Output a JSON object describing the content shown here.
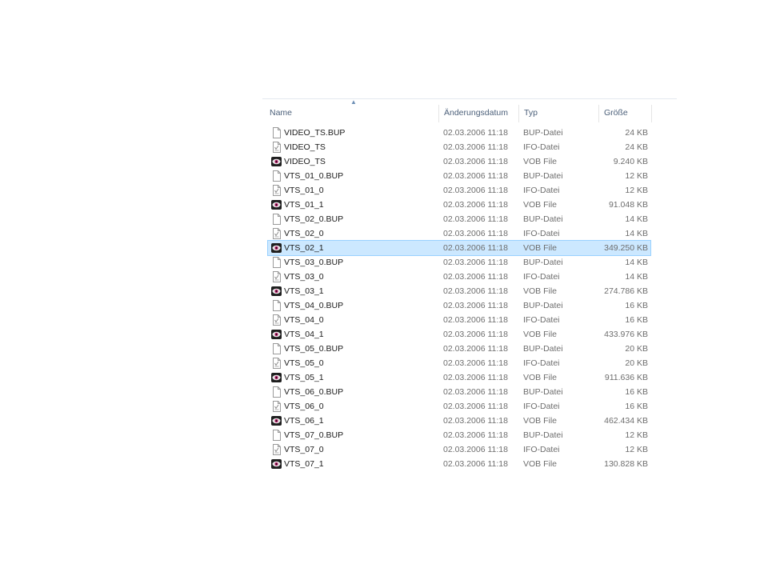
{
  "columns": {
    "name": "Name",
    "date": "Änderungsdatum",
    "type": "Typ",
    "size": "Größe"
  },
  "sort": {
    "column": "name",
    "direction": "ascending"
  },
  "colors": {
    "selected_bg": "#cce8ff",
    "selected_border": "#99d1ff",
    "header_text": "#4c607a",
    "detail_text": "#6d6d6d"
  },
  "files": [
    {
      "name": "VIDEO_TS.BUP",
      "date": "02.03.2006 11:18",
      "type": "BUP-Datei",
      "size": "24 KB",
      "icon": "blank-file-icon"
    },
    {
      "name": "VIDEO_TS",
      "date": "02.03.2006 11:18",
      "type": "IFO-Datei",
      "size": "24 KB",
      "icon": "info-file-icon"
    },
    {
      "name": "VIDEO_TS",
      "date": "02.03.2006 11:18",
      "type": "VOB File",
      "size": "9.240 KB",
      "icon": "vob-eye-icon"
    },
    {
      "name": "VTS_01_0.BUP",
      "date": "02.03.2006 11:18",
      "type": "BUP-Datei",
      "size": "12 KB",
      "icon": "blank-file-icon"
    },
    {
      "name": "VTS_01_0",
      "date": "02.03.2006 11:18",
      "type": "IFO-Datei",
      "size": "12 KB",
      "icon": "info-file-icon"
    },
    {
      "name": "VTS_01_1",
      "date": "02.03.2006 11:18",
      "type": "VOB File",
      "size": "91.048 KB",
      "icon": "vob-eye-icon"
    },
    {
      "name": "VTS_02_0.BUP",
      "date": "02.03.2006 11:18",
      "type": "BUP-Datei",
      "size": "14 KB",
      "icon": "blank-file-icon"
    },
    {
      "name": "VTS_02_0",
      "date": "02.03.2006 11:18",
      "type": "IFO-Datei",
      "size": "14 KB",
      "icon": "info-file-icon"
    },
    {
      "name": "VTS_02_1",
      "date": "02.03.2006 11:18",
      "type": "VOB File",
      "size": "349.250 KB",
      "icon": "vob-eye-icon",
      "selected": true
    },
    {
      "name": "VTS_03_0.BUP",
      "date": "02.03.2006 11:18",
      "type": "BUP-Datei",
      "size": "14 KB",
      "icon": "blank-file-icon"
    },
    {
      "name": "VTS_03_0",
      "date": "02.03.2006 11:18",
      "type": "IFO-Datei",
      "size": "14 KB",
      "icon": "info-file-icon"
    },
    {
      "name": "VTS_03_1",
      "date": "02.03.2006 11:18",
      "type": "VOB File",
      "size": "274.786 KB",
      "icon": "vob-eye-icon"
    },
    {
      "name": "VTS_04_0.BUP",
      "date": "02.03.2006 11:18",
      "type": "BUP-Datei",
      "size": "16 KB",
      "icon": "blank-file-icon"
    },
    {
      "name": "VTS_04_0",
      "date": "02.03.2006 11:18",
      "type": "IFO-Datei",
      "size": "16 KB",
      "icon": "info-file-icon"
    },
    {
      "name": "VTS_04_1",
      "date": "02.03.2006 11:18",
      "type": "VOB File",
      "size": "433.976 KB",
      "icon": "vob-eye-icon"
    },
    {
      "name": "VTS_05_0.BUP",
      "date": "02.03.2006 11:18",
      "type": "BUP-Datei",
      "size": "20 KB",
      "icon": "blank-file-icon"
    },
    {
      "name": "VTS_05_0",
      "date": "02.03.2006 11:18",
      "type": "IFO-Datei",
      "size": "20 KB",
      "icon": "info-file-icon"
    },
    {
      "name": "VTS_05_1",
      "date": "02.03.2006 11:18",
      "type": "VOB File",
      "size": "911.636 KB",
      "icon": "vob-eye-icon"
    },
    {
      "name": "VTS_06_0.BUP",
      "date": "02.03.2006 11:18",
      "type": "BUP-Datei",
      "size": "16 KB",
      "icon": "blank-file-icon"
    },
    {
      "name": "VTS_06_0",
      "date": "02.03.2006 11:18",
      "type": "IFO-Datei",
      "size": "16 KB",
      "icon": "info-file-icon"
    },
    {
      "name": "VTS_06_1",
      "date": "02.03.2006 11:18",
      "type": "VOB File",
      "size": "462.434 KB",
      "icon": "vob-eye-icon"
    },
    {
      "name": "VTS_07_0.BUP",
      "date": "02.03.2006 11:18",
      "type": "BUP-Datei",
      "size": "12 KB",
      "icon": "blank-file-icon"
    },
    {
      "name": "VTS_07_0",
      "date": "02.03.2006 11:18",
      "type": "IFO-Datei",
      "size": "12 KB",
      "icon": "info-file-icon"
    },
    {
      "name": "VTS_07_1",
      "date": "02.03.2006 11:18",
      "type": "VOB File",
      "size": "130.828 KB",
      "icon": "vob-eye-icon"
    }
  ]
}
